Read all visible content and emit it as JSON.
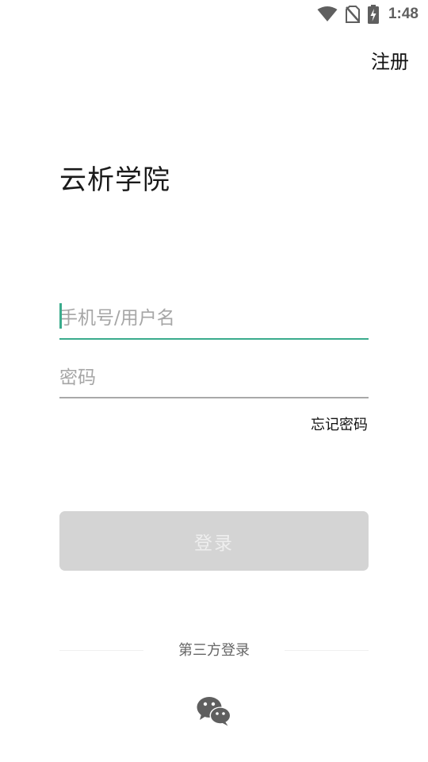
{
  "status_bar": {
    "time": "1:48",
    "icons": [
      "wifi-icon",
      "no-sim-icon",
      "battery-charging-icon"
    ]
  },
  "header": {
    "register_label": "注册"
  },
  "app": {
    "title": "云析学院"
  },
  "form": {
    "username_placeholder": "手机号/用户名",
    "password_placeholder": "密码",
    "forgot_password_label": "忘记密码",
    "login_label": "登录"
  },
  "third_party": {
    "label": "第三方登录",
    "providers": [
      "wechat-icon"
    ]
  },
  "colors": {
    "accent": "#3aab8c",
    "button_disabled": "#d4d4d4",
    "status_icons": "#5f5f5f"
  }
}
